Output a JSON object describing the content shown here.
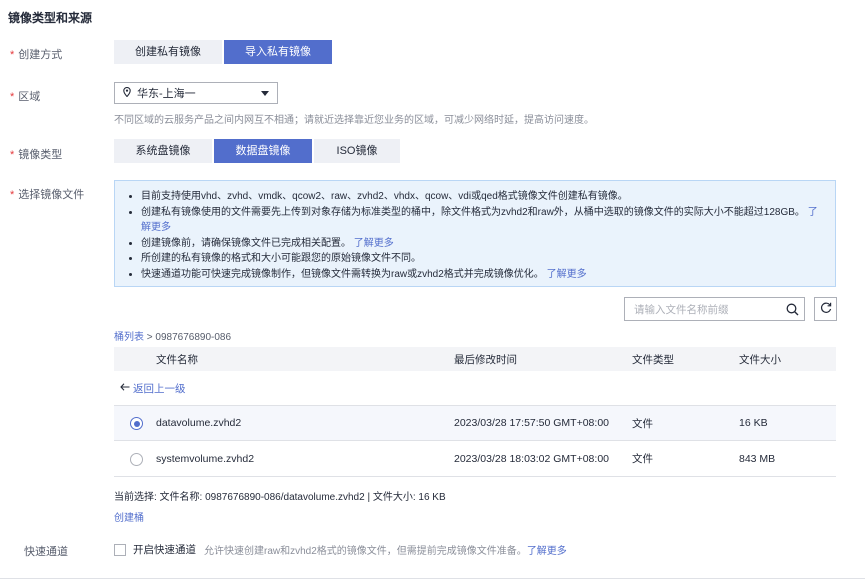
{
  "section_title": "镜像类型和来源",
  "create_method": {
    "label": "创建方式",
    "options": [
      "创建私有镜像",
      "导入私有镜像"
    ],
    "selected": "导入私有镜像"
  },
  "region": {
    "label": "区域",
    "value": "华东-上海一",
    "hint": "不同区域的云服务产品之间内网互不相通；请就近选择靠近您业务的区域，可减少网络时延，提高访问速度。"
  },
  "image_type": {
    "label": "镜像类型",
    "options": [
      "系统盘镜像",
      "数据盘镜像",
      "ISO镜像"
    ],
    "selected": "数据盘镜像"
  },
  "select_file": {
    "label": "选择镜像文件",
    "info": [
      {
        "text": "目前支持使用vhd、zvhd、vmdk、qcow2、raw、zvhd2、vhdx、qcow、vdi或qed格式镜像文件创建私有镜像。",
        "link": ""
      },
      {
        "text": "创建私有镜像使用的文件需要先上传到对象存储为标准类型的桶中，除文件格式为zvhd2和raw外，从桶中选取的镜像文件的实际大小不能超过128GB。",
        "link": "了解更多"
      },
      {
        "text": "创建镜像前，请确保镜像文件已完成相关配置。",
        "link": "了解更多"
      },
      {
        "text": "所创建的私有镜像的格式和大小可能跟您的原始镜像文件不同。",
        "link": ""
      },
      {
        "text": "快速通道功能可快速完成镜像制作，但镜像文件需转换为raw或zvhd2格式并完成镜像优化。",
        "link": "了解更多"
      }
    ],
    "search_placeholder": "请输入文件名称前缀",
    "breadcrumb_root": "桶列表",
    "breadcrumb_sep": ">",
    "breadcrumb_current": "0987676890-086",
    "table": {
      "headers": [
        "文件名称",
        "最后修改时间",
        "文件类型",
        "文件大小"
      ],
      "back_label": "返回上一级",
      "rows": [
        {
          "name": "datavolume.zvhd2",
          "modified": "2023/03/28 17:57:50 GMT+08:00",
          "type": "文件",
          "size": "16 KB",
          "selected": true
        },
        {
          "name": "systemvolume.zvhd2",
          "modified": "2023/03/28 18:03:02 GMT+08:00",
          "type": "文件",
          "size": "843 MB",
          "selected": false
        }
      ]
    },
    "current_selection": "当前选择: 文件名称: 0987676890-086/datavolume.zvhd2 | 文件大小: 16 KB",
    "create_bucket": "创建桶"
  },
  "fast_channel": {
    "label": "快速通道",
    "checkbox_label": "开启快速通道",
    "hint": "允许快速创建raw和zvhd2格式的镜像文件，但需提前完成镜像文件准备。",
    "link": "了解更多",
    "checked": false
  },
  "colors": {
    "accent": "#526ecc",
    "required": "#e4393c",
    "info_bg": "#eaf3fc"
  }
}
